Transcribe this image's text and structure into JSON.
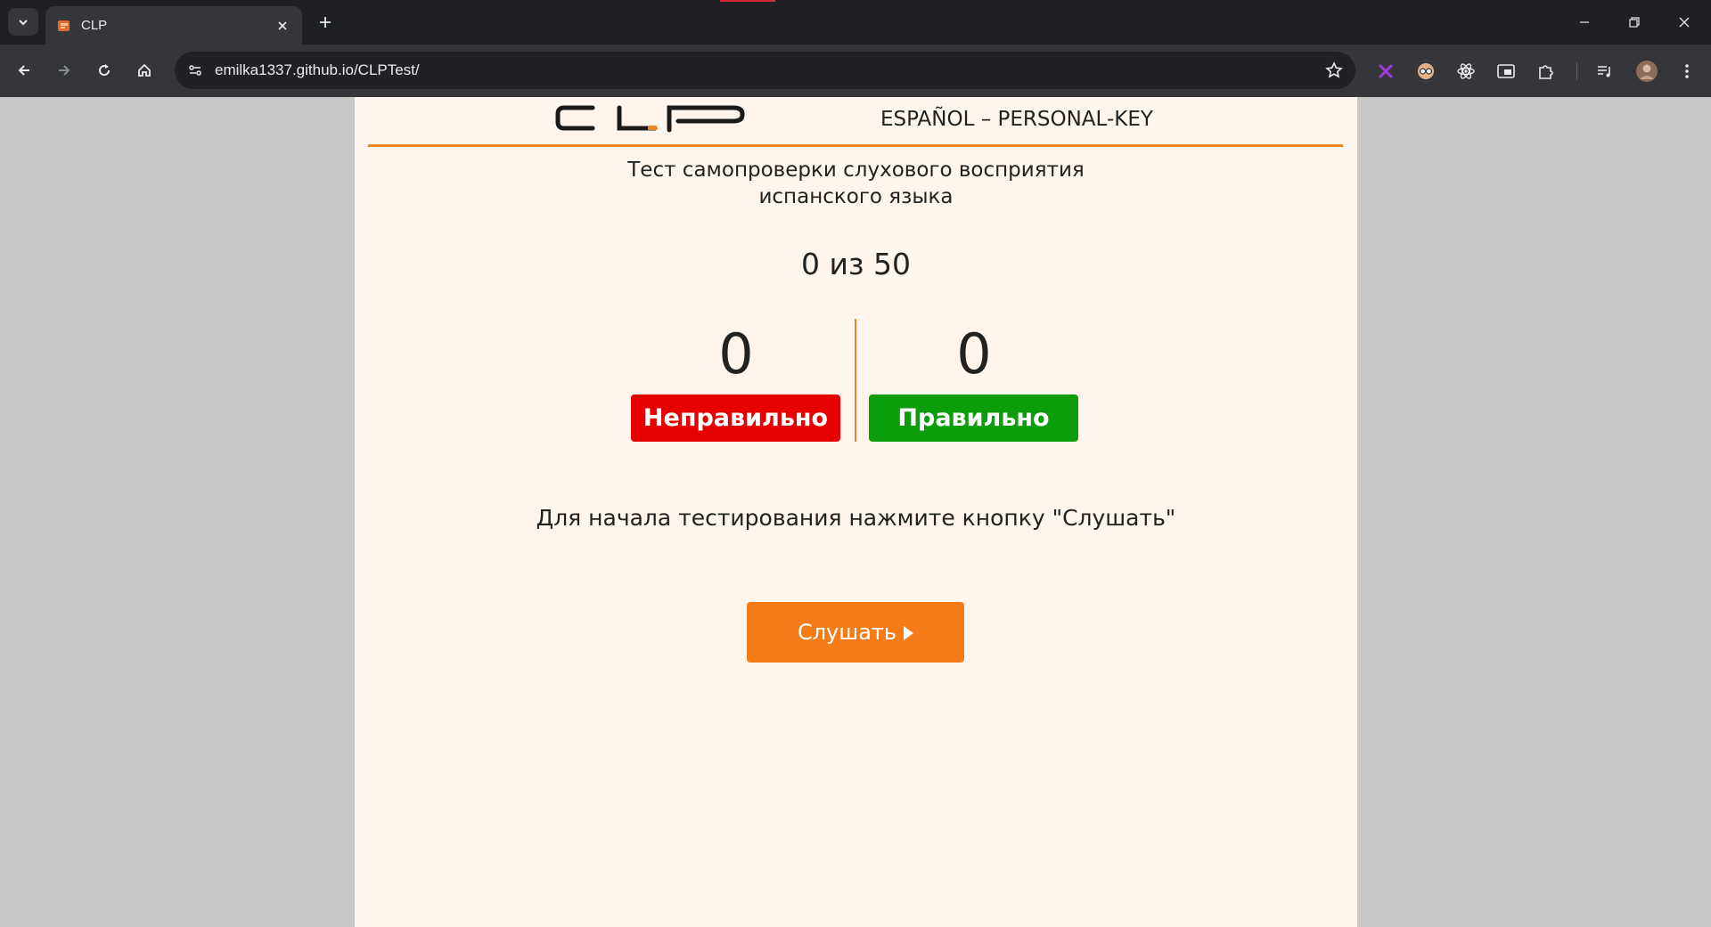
{
  "browser": {
    "tab_title": "CLP",
    "url": "emilka1337.github.io/CLPTest/",
    "icons": [
      "chevron-down-icon",
      "close-icon",
      "plus-icon",
      "minimize-icon",
      "restore-icon",
      "back-icon",
      "forward-icon",
      "reload-icon",
      "home-icon",
      "site-info-icon",
      "star-icon",
      "extension-icons",
      "puzzle-icon",
      "media-icon",
      "profile-avatar"
    ]
  },
  "page": {
    "brand_title": "ESPAÑOL – PERSONAL-KEY",
    "test_title_line1": "Тест самопроверки слухового восприятия",
    "test_title_line2": "испанского языка",
    "counter": "0 из 50",
    "wrong_count": "0",
    "wrong_label": "Неправильно",
    "right_count": "0",
    "right_label": "Правильно",
    "instruction": "Для начала тестирования нажмите кнопку \"Слушать\"",
    "listen_label": "Слушать"
  },
  "colors": {
    "accent_orange": "#f47b16",
    "wrong_red": "#e60000",
    "right_green": "#0c9d0c",
    "page_bg": "#fff5ec"
  }
}
